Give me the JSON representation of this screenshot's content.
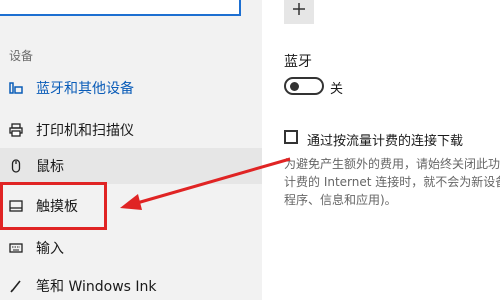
{
  "nav": {
    "group_label": "设备",
    "items": [
      {
        "label": "蓝牙和其他设备",
        "icon": "bluetooth-devices-icon"
      },
      {
        "label": "打印机和扫描仪",
        "icon": "printer-icon"
      },
      {
        "label": "鼠标",
        "icon": "mouse-icon"
      },
      {
        "label": "触摸板",
        "icon": "touchpad-icon"
      },
      {
        "label": "输入",
        "icon": "keyboard-icon"
      },
      {
        "label": "笔和 Windows Ink",
        "icon": "pen-icon"
      }
    ],
    "accent_color": "#0a5cb8",
    "highlight_color": "#e02424"
  },
  "content": {
    "add_icon": "plus-icon",
    "top_partial_text": "• · · · ·",
    "bluetooth": {
      "title": "蓝牙",
      "toggle_state": "关"
    },
    "metered": {
      "label": "通过按流量计费的连接下载",
      "description": "为避免产生额外的费用，请始终关闭此功\n计费的 Internet 连接时，就不会为新设备\n程序、信息和应用)。"
    }
  }
}
